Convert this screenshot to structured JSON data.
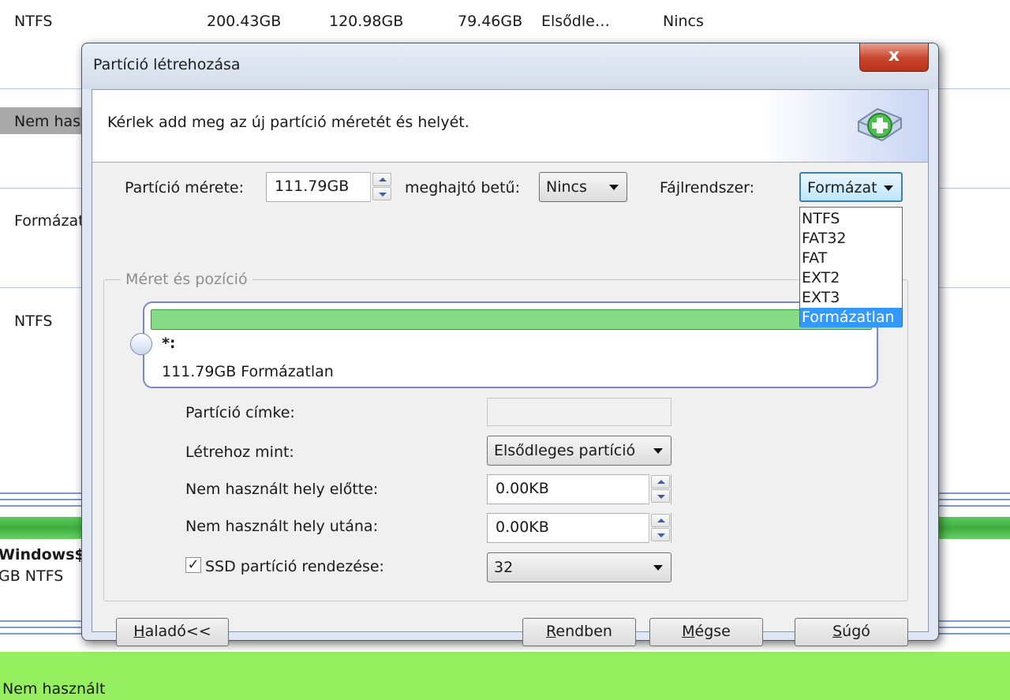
{
  "background": {
    "top_row": {
      "filesystem": "NTFS",
      "capacity": "200.43GB",
      "used": "120.98GB",
      "unused": "79.46GB",
      "type": "Elsődle…",
      "status": "Nincs"
    },
    "side_items": [
      "Nem hasz",
      "Formázat",
      "NTFS"
    ],
    "disk_partition": {
      "name": "Windows$",
      "detail": "GB NTFS"
    },
    "unallocated_label": "Nem használt"
  },
  "dialog": {
    "title": "Partíció létrehozása",
    "close_label": "x",
    "instruction": "Kérlek add meg az új partíció méretét és helyét.",
    "partition_size_label": "Partíció mérete:",
    "partition_size_value": "111.79GB",
    "drive_letter_label": "meghajtó betű:",
    "drive_letter_value": "Nincs",
    "filesystem_label": "Fájlrendszer:",
    "filesystem_value": "Formázat",
    "filesystem_options": [
      "NTFS",
      "FAT32",
      "FAT",
      "EXT2",
      "EXT3",
      "Formázatlan"
    ],
    "filesystem_selected_index": 5,
    "group_title": "Méret és pozíció",
    "disk_map": {
      "name": "*:",
      "size_text": "111.79GB Formázatlan"
    },
    "partition_label_label": "Partíció címke:",
    "partition_label_value": "",
    "create_as_label": "Létrehoz mint:",
    "create_as_value": "Elsődleges partíció",
    "unused_before_label": "Nem használt hely előtte:",
    "unused_before_value": "0.00KB",
    "unused_after_label": "Nem használt hely utána:",
    "unused_after_value": "0.00KB",
    "ssd_align_label": "SSD partíció rendezése:",
    "ssd_align_checked": true,
    "ssd_align_value": "32",
    "buttons": {
      "advanced": {
        "mnemonic": "H",
        "rest": "aladó<<"
      },
      "ok": {
        "mnemonic": "R",
        "rest": "endben"
      },
      "cancel": {
        "mnemonic": "M",
        "rest": "égse"
      },
      "help": {
        "mnemonic": "S",
        "rest": "úgó"
      }
    },
    "colors": {
      "partition_bar": "#86dc86",
      "selection": "#3399ff",
      "close_button": "#c8442c"
    }
  }
}
